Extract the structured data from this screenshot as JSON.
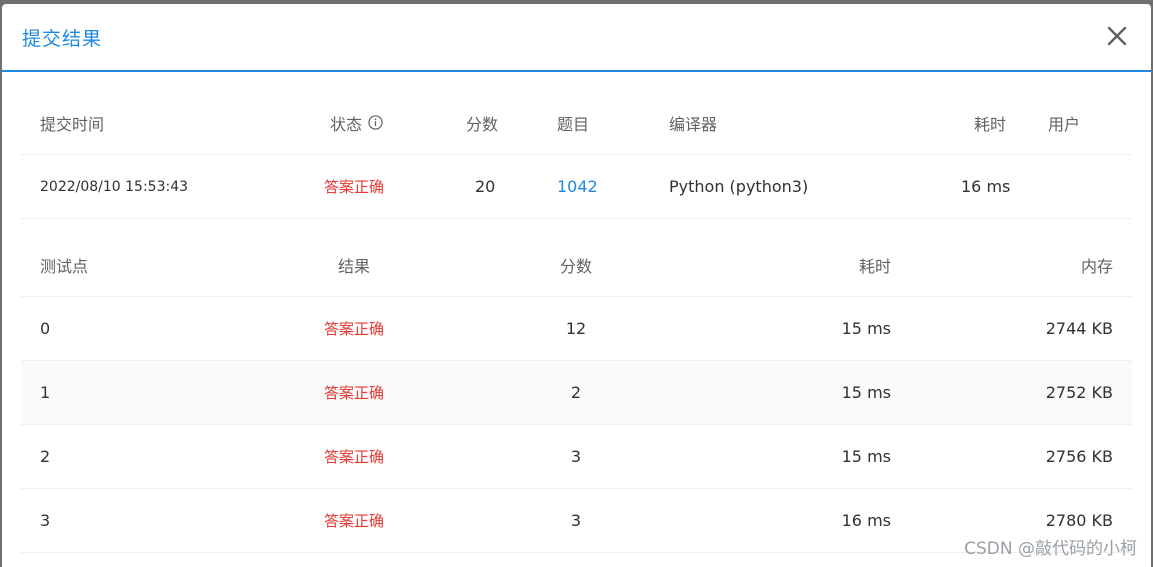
{
  "dialog": {
    "title": "提交结果"
  },
  "summary": {
    "headers": {
      "submit_time": "提交时间",
      "status": "状态",
      "score": "分数",
      "problem": "题目",
      "compiler": "编译器",
      "time": "耗时",
      "user": "用户"
    },
    "row": {
      "submit_time": "2022/08/10 15:53:43",
      "status": "答案正确",
      "score": "20",
      "problem": "1042",
      "compiler": "Python (python3)",
      "time": "16 ms",
      "user": ""
    }
  },
  "testcases": {
    "headers": {
      "case": "测试点",
      "result": "结果",
      "score": "分数",
      "time": "耗时",
      "memory": "内存"
    },
    "rows": [
      {
        "case": "0",
        "result": "答案正确",
        "score": "12",
        "time": "15 ms",
        "memory": "2744 KB"
      },
      {
        "case": "1",
        "result": "答案正确",
        "score": "2",
        "time": "15 ms",
        "memory": "2752 KB"
      },
      {
        "case": "2",
        "result": "答案正确",
        "score": "3",
        "time": "15 ms",
        "memory": "2756 KB"
      },
      {
        "case": "3",
        "result": "答案正确",
        "score": "3",
        "time": "16 ms",
        "memory": "2780 KB"
      }
    ]
  },
  "watermark": "CSDN @敲代码的小柯",
  "colors": {
    "accent": "#1e88e5",
    "success_text": "#e53935"
  }
}
